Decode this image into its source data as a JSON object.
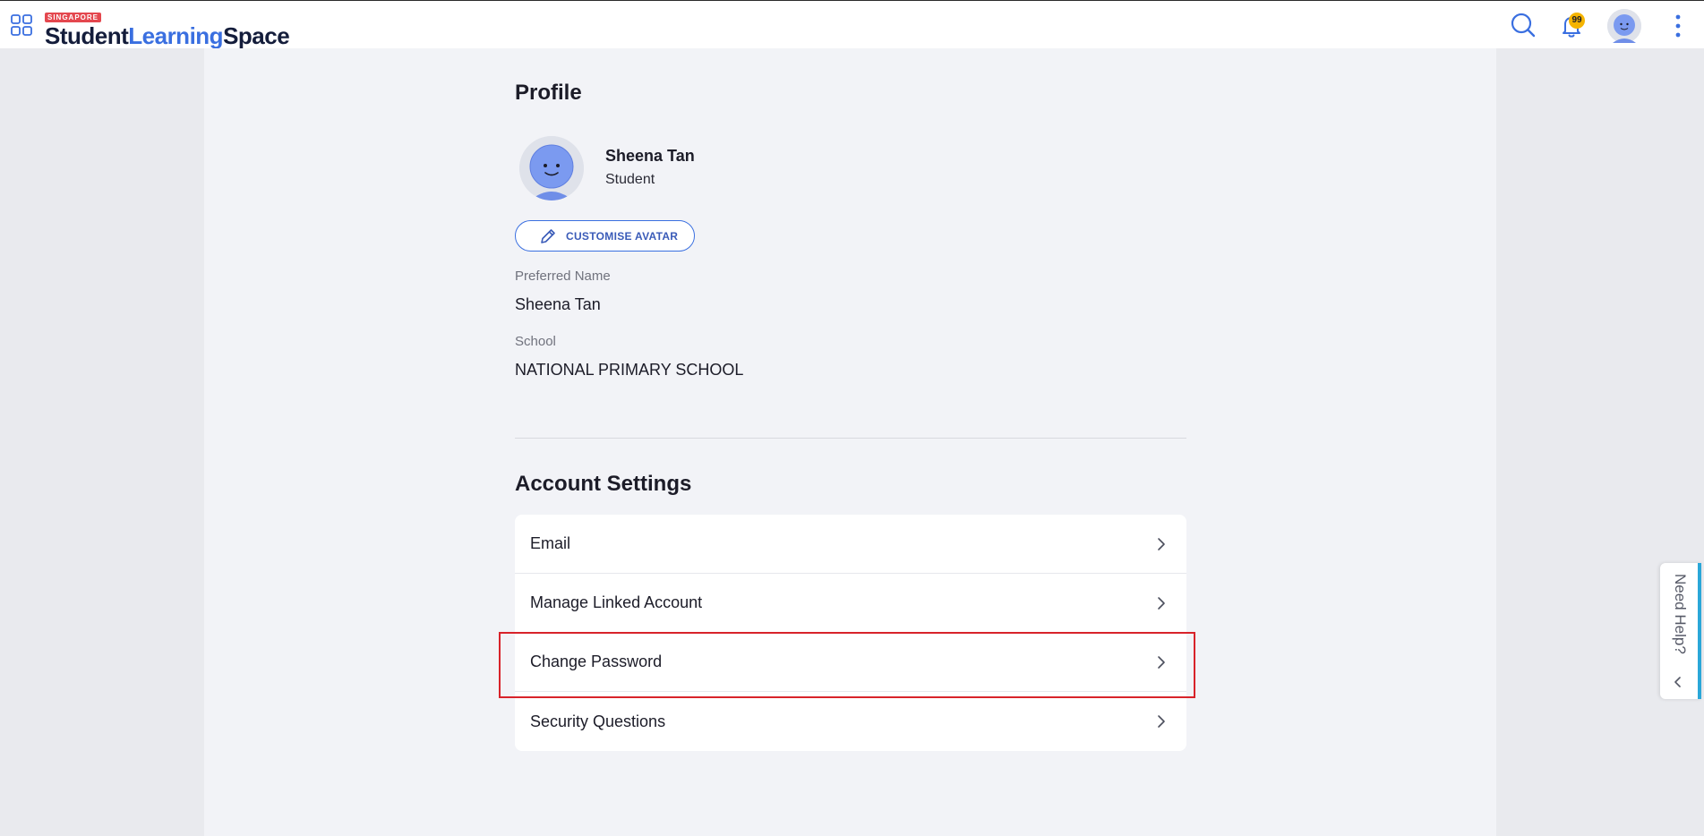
{
  "header": {
    "logo_badge": "SINGAPORE",
    "logo_word1": "Student",
    "logo_word2": "Learning",
    "logo_word3": "Space",
    "notification_count": "99",
    "icons": [
      "apps-grid-icon",
      "search-icon",
      "bell-icon",
      "avatar",
      "more-vertical-icon"
    ]
  },
  "profile": {
    "heading": "Profile",
    "name": "Sheena Tan",
    "role": "Student",
    "customise_label": "CUSTOMISE AVATAR",
    "preferred_name_label": "Preferred Name",
    "preferred_name_value": "Sheena Tan",
    "school_label": "School",
    "school_value": "NATIONAL PRIMARY SCHOOL"
  },
  "account": {
    "heading": "Account Settings",
    "items": [
      {
        "label": "Email"
      },
      {
        "label": "Manage Linked Account"
      },
      {
        "label": "Change Password"
      },
      {
        "label": "Security Questions"
      }
    ]
  },
  "help": {
    "label": "Need Help?"
  },
  "colors": {
    "brand_blue": "#3a6fe0",
    "brand_navy": "#141d3b",
    "highlight_red": "#d8232a",
    "badge_yellow": "#f5b400"
  }
}
